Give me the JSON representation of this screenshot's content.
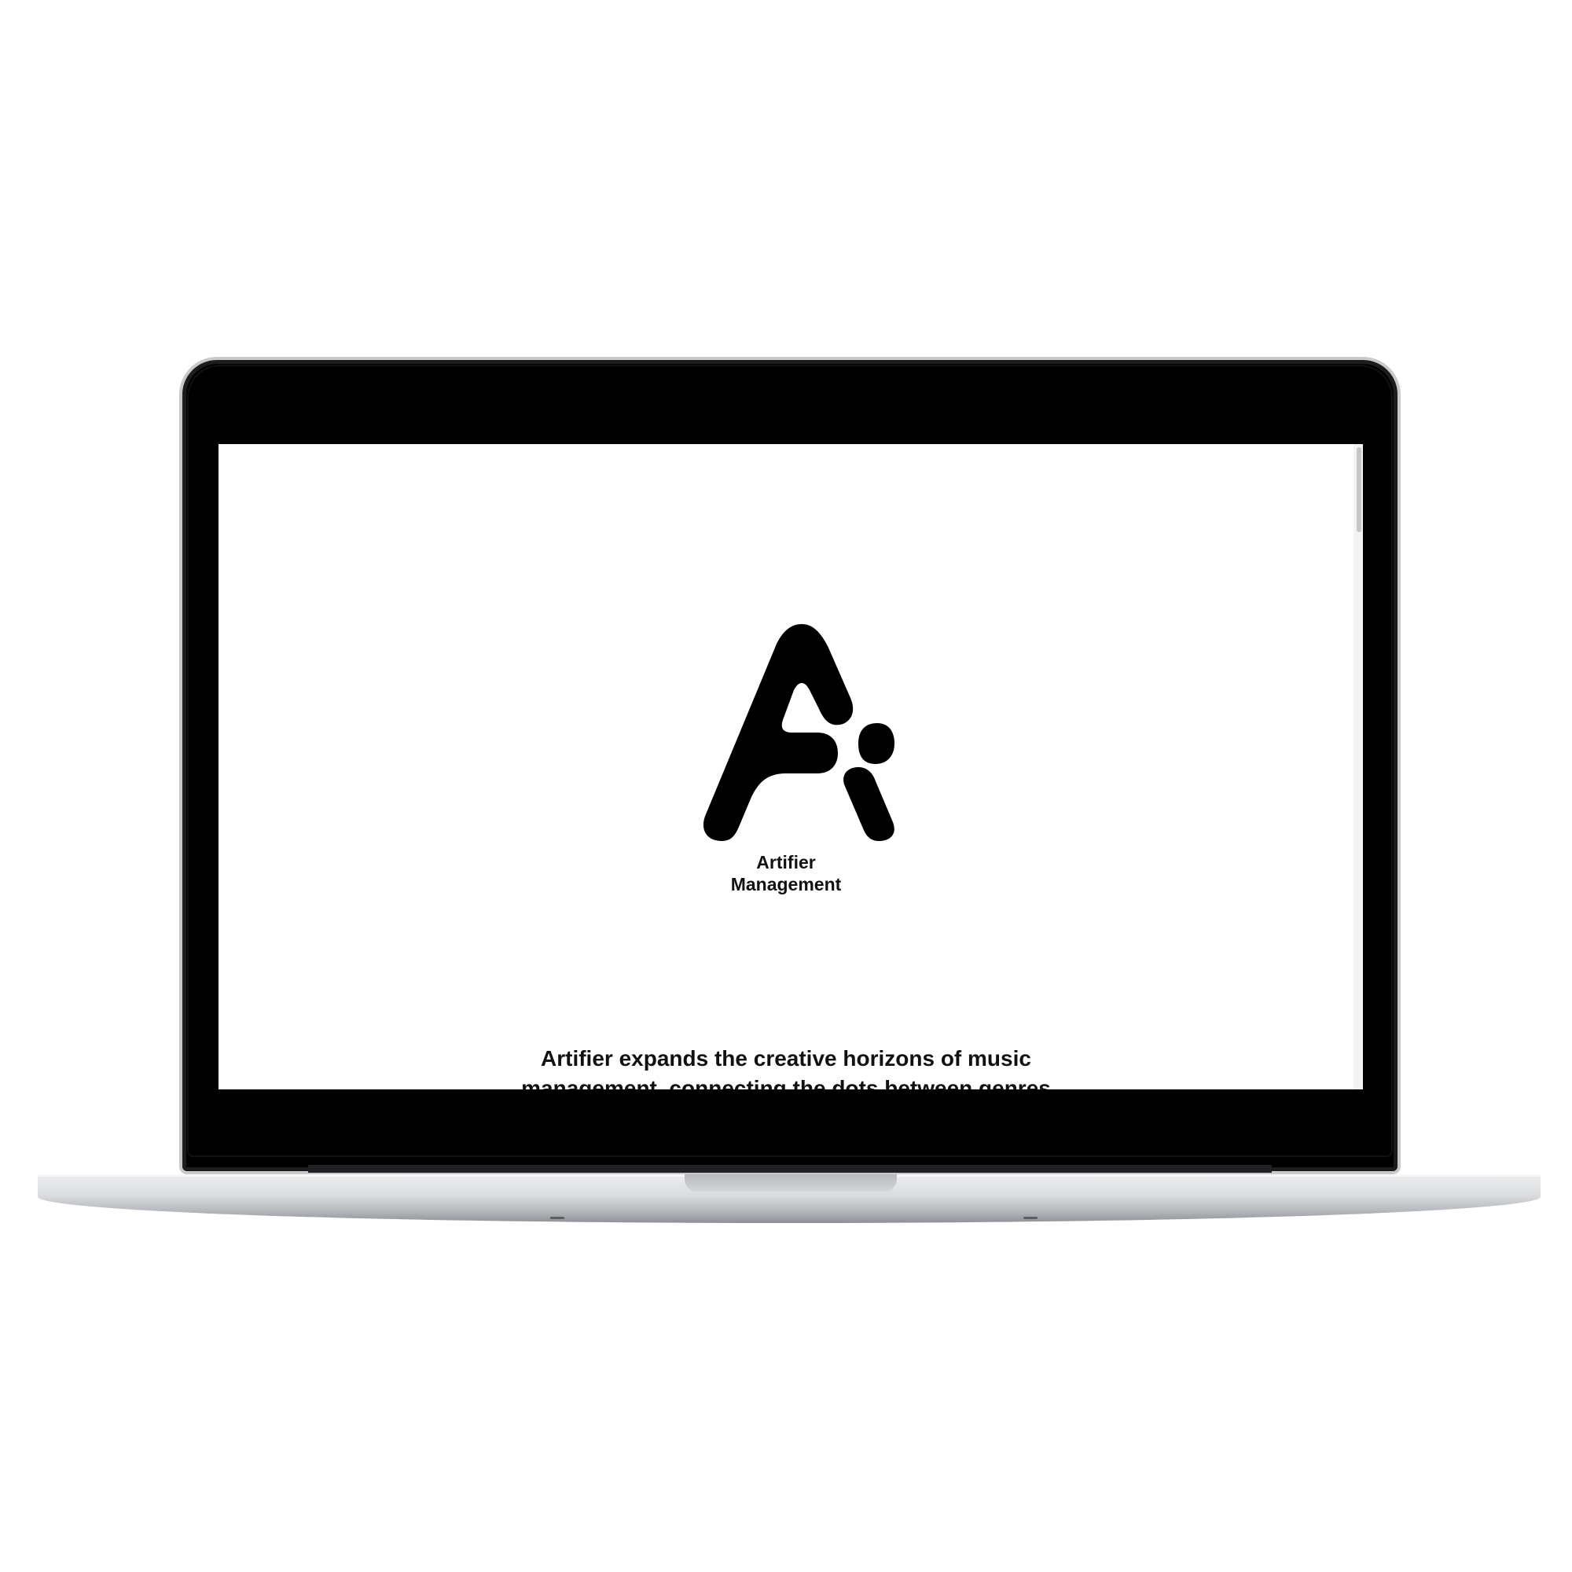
{
  "site": {
    "brand_name_line1": "Artifier",
    "brand_name_line2": "Management",
    "tagline": "Artifier expands the creative horizons of music management, connecting the dots between genres",
    "logo_icon": "artifier-ai-logo"
  },
  "colors": {
    "screen_background": "#ffffff",
    "text": "#111111",
    "bezel": "#000000",
    "laptop_body": "#d9dbde"
  }
}
